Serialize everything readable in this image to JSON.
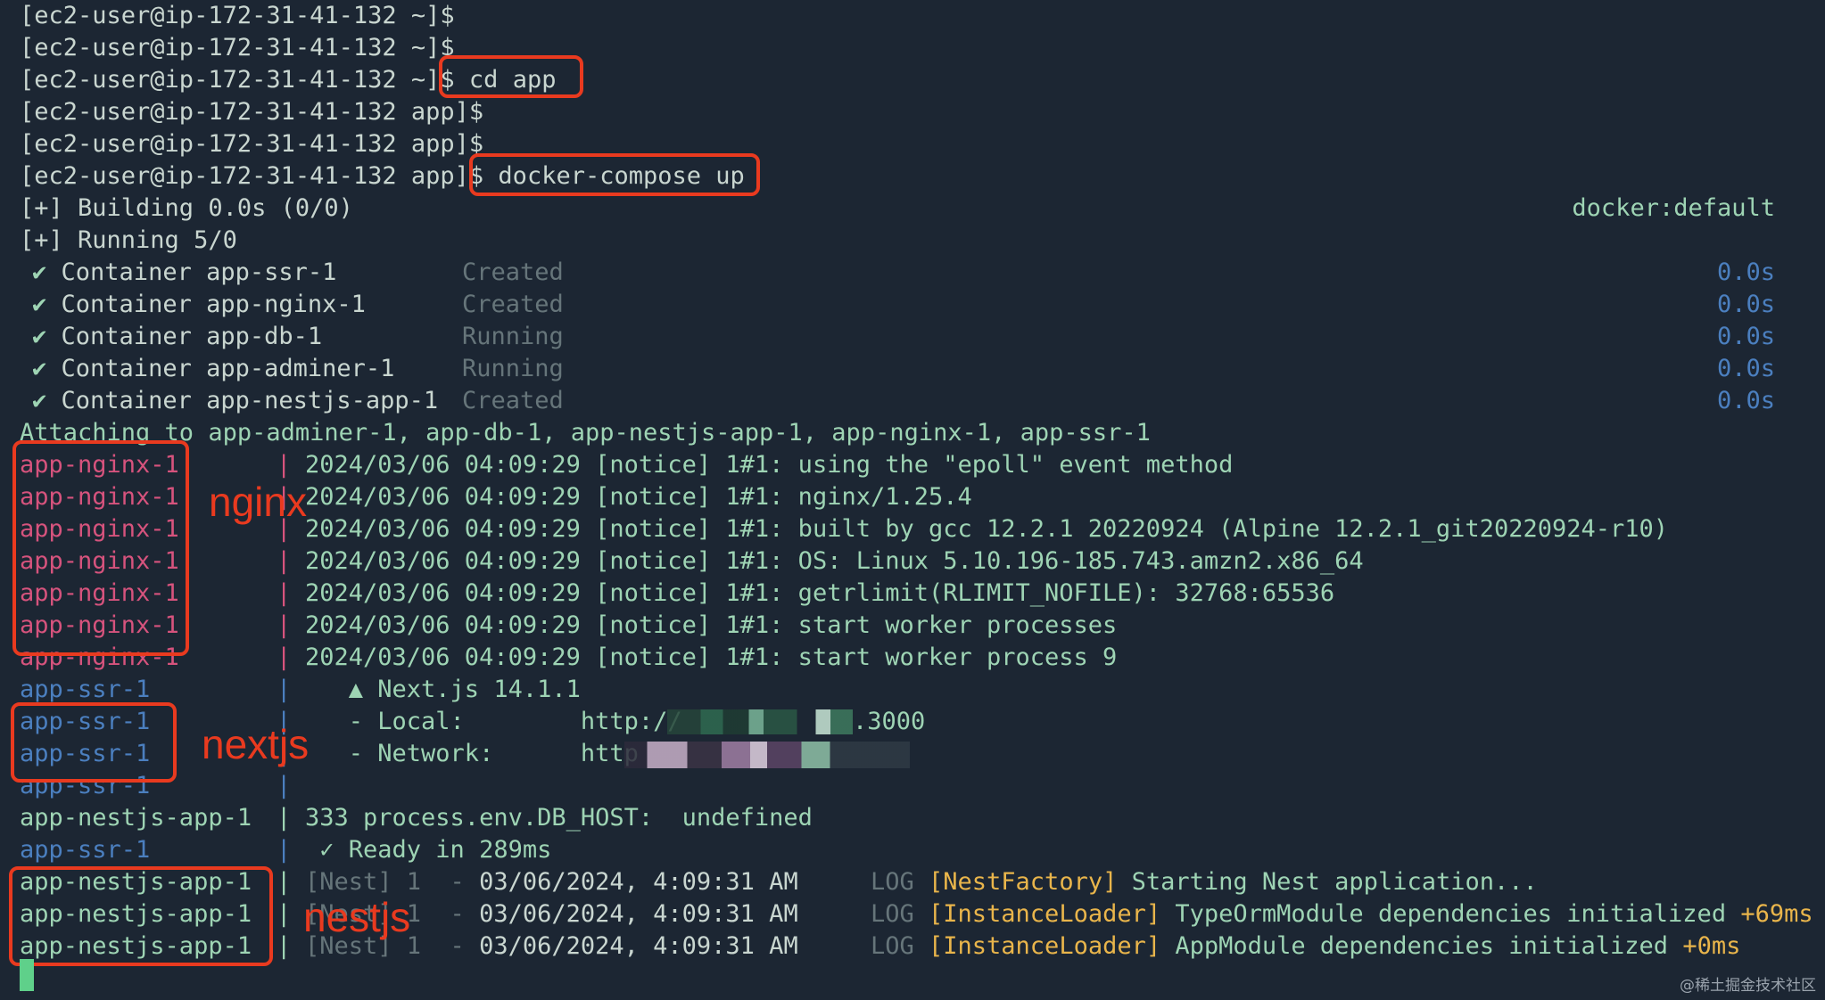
{
  "prompt_lines": [
    {
      "prompt": "[ec2-user@ip-172-31-41-132 ~]$",
      "cmd": ""
    },
    {
      "prompt": "[ec2-user@ip-172-31-41-132 ~]$",
      "cmd": ""
    },
    {
      "prompt": "[ec2-user@ip-172-31-41-132 ~]$",
      "cmd": " cd app"
    },
    {
      "prompt": "[ec2-user@ip-172-31-41-132 app]$",
      "cmd": ""
    },
    {
      "prompt": "[ec2-user@ip-172-31-41-132 app]$",
      "cmd": ""
    },
    {
      "prompt": "[ec2-user@ip-172-31-41-132 app]$",
      "cmd": " docker-compose up"
    }
  ],
  "build": {
    "building": "[+] Building 0.0s (0/0)",
    "context": "docker:default",
    "running": "[+] Running 5/0"
  },
  "containers": [
    {
      "check": "✔",
      "name": "Container app-ssr-1",
      "status": "Created",
      "time": "0.0s"
    },
    {
      "check": "✔",
      "name": "Container app-nginx-1",
      "status": "Created",
      "time": "0.0s"
    },
    {
      "check": "✔",
      "name": "Container app-db-1",
      "status": "Running",
      "time": "0.0s"
    },
    {
      "check": "✔",
      "name": "Container app-adminer-1",
      "status": "Running",
      "time": "0.0s"
    },
    {
      "check": "✔",
      "name": "Container app-nestjs-app-1",
      "status": "Created",
      "time": "0.0s"
    }
  ],
  "attaching": "Attaching to app-adminer-1, app-db-1, app-nestjs-app-1, app-nginx-1, app-ssr-1",
  "log_lines": [
    {
      "svc": "app-nginx-1",
      "msg": "2024/03/06 04:09:29 [notice] 1#1: using the \"epoll\" event method"
    },
    {
      "svc": "app-nginx-1",
      "msg": "2024/03/06 04:09:29 [notice] 1#1: nginx/1.25.4"
    },
    {
      "svc": "app-nginx-1",
      "msg": "2024/03/06 04:09:29 [notice] 1#1: built by gcc 12.2.1 20220924 (Alpine 12.2.1_git20220924-r10)"
    },
    {
      "svc": "app-nginx-1",
      "msg": "2024/03/06 04:09:29 [notice] 1#1: OS: Linux 5.10.196-185.743.amzn2.x86_64"
    },
    {
      "svc": "app-nginx-1",
      "msg": "2024/03/06 04:09:29 [notice] 1#1: getrlimit(RLIMIT_NOFILE): 32768:65536"
    },
    {
      "svc": "app-nginx-1",
      "msg": "2024/03/06 04:09:29 [notice] 1#1: start worker processes"
    },
    {
      "svc": "app-nginx-1",
      "msg": "2024/03/06 04:09:29 [notice] 1#1: start worker process 9"
    },
    {
      "svc": "app-ssr-1",
      "msg": "   ▲ Next.js 14.1.1"
    },
    {
      "svc": "app-ssr-1",
      "msg": "   - Local:        http://",
      "tail": ".3000"
    },
    {
      "svc": "app-ssr-1",
      "msg": "   - Network:      http"
    },
    {
      "svc": "app-ssr-1",
      "msg": ""
    },
    {
      "svc": "app-nestjs-app-1",
      "msg": "333 process.env.DB_HOST:  undefined"
    },
    {
      "svc": "app-ssr-1",
      "msg": " ✓ Ready in 289ms"
    },
    {
      "svc": "app-nestjs-app-1",
      "nest": "[Nest] 1  - ",
      "date": "03/06/2024, 4:09:31 AM",
      "log": "     LOG ",
      "ctx": "[NestFactory]",
      "text": " Starting Nest application...",
      "extra": ""
    },
    {
      "svc": "app-nestjs-app-1",
      "nest": "[Nest] 1  - ",
      "date": "03/06/2024, 4:09:31 AM",
      "log": "     LOG ",
      "ctx": "[InstanceLoader]",
      "text": " TypeOrmModule dependencies initialized ",
      "extra": "+69ms"
    },
    {
      "svc": "app-nestjs-app-1",
      "nest": "[Nest] 1  - ",
      "date": "03/06/2024, 4:09:31 AM",
      "log": "     LOG ",
      "ctx": "[InstanceLoader]",
      "text": " AppModule dependencies initialized ",
      "extra": "+0ms"
    }
  ],
  "annotations": {
    "nginx": "nginx",
    "nextjs": "nextjs",
    "nestjs": "nestjs"
  },
  "watermark": "@稀土掘金技术社区",
  "colors": {
    "background": "#1c2633",
    "annotation": "#e93a1f",
    "nginx": "#d6537d",
    "ssr": "#4b7fbf",
    "nest": "#9ed4b4",
    "context": "#e9b54b"
  }
}
